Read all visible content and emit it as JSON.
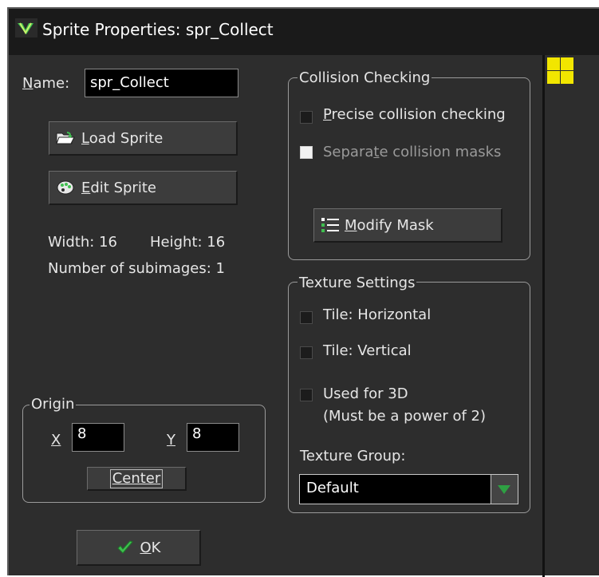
{
  "window": {
    "title": "Sprite Properties: spr_Collect"
  },
  "name_field": {
    "label_prefix": "N",
    "label_rest": "ame:",
    "value": "spr_Collect"
  },
  "buttons": {
    "load_sprite": {
      "mnemonic": "L",
      "rest": "oad Sprite"
    },
    "edit_sprite": {
      "mnemonic": "E",
      "rest": "dit Sprite"
    },
    "ok": {
      "mnemonic": "O",
      "rest": "K"
    }
  },
  "info": {
    "width_text": "Width: 16",
    "height_text": "Height: 16",
    "subimages_text": "Number of subimages: 1"
  },
  "origin": {
    "title": "Origin",
    "x_label": "X",
    "x_value": "8",
    "y_label": "Y",
    "y_value": "8",
    "center_label": "Center"
  },
  "collision": {
    "title": "Collision Checking",
    "precise": {
      "mnemonic": "P",
      "rest": "recise collision checking",
      "checked": false
    },
    "separate": {
      "before": "Separa",
      "mnemonic": "t",
      "rest": "e collision masks",
      "enabled": false
    },
    "modify_mask": {
      "mnemonic": "M",
      "rest": "odify Mask"
    }
  },
  "texture": {
    "title": "Texture Settings",
    "tile_h": "Tile: Horizontal",
    "tile_v": "Tile: Vertical",
    "used_3d": "Used for 3D",
    "used_3d_note": "(Must be a power of 2)",
    "group_label": "Texture Group:",
    "group_value": "Default"
  },
  "colors": {
    "window_bg": "#2d2d2d",
    "titlebar_bg": "#1a1a1a",
    "accent_green": "#2ea043",
    "preview_yellow": "#f2e600"
  },
  "icons": {
    "app": "gamemaker-icon",
    "load": "folder-open-icon",
    "edit": "palette-icon",
    "mask": "list-icon",
    "ok": "checkmark-icon",
    "dropdown": "triangle-down-icon",
    "preview": "sprite-preview-icon"
  }
}
